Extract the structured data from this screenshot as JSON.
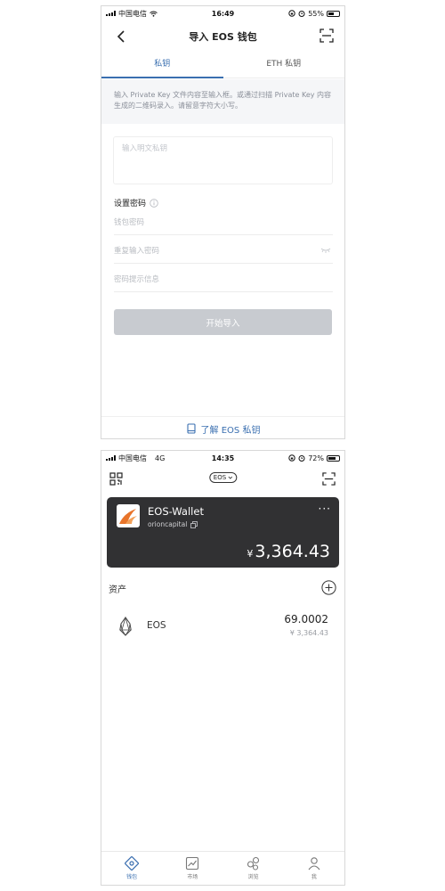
{
  "screen1": {
    "status": {
      "carrier": "中国电信",
      "time": "16:49",
      "battery": "55%",
      "battery_level": 0.55
    },
    "title": "导入 EOS 钱包",
    "tabs": [
      {
        "label": "私钥",
        "active": true
      },
      {
        "label": "ETH 私钥",
        "active": false
      }
    ],
    "hint": "输入 Private Key 文件内容至输入框。或通过扫描 Private Key 内容生成的二维码录入。请留意字符大小写。",
    "private_key_placeholder": "输入明文私钥",
    "password_section_title": "设置密码",
    "fields": [
      {
        "placeholder": "钱包密码"
      },
      {
        "placeholder": "重复输入密码"
      },
      {
        "placeholder": "密码提示信息"
      }
    ],
    "start_button": "开始导入",
    "learn_link": "了解 EOS 私钥"
  },
  "screen2": {
    "status": {
      "carrier": "中国电信",
      "network": "4G",
      "time": "14:35",
      "battery": "72%",
      "battery_level": 0.72
    },
    "chain_selector": "EOS",
    "wallet": {
      "name": "EOS-Wallet",
      "account": "orioncapital",
      "currency_symbol": "¥",
      "balance": "3,364.43"
    },
    "assets_title": "资产",
    "assets": [
      {
        "name": "EOS",
        "amount": "69.0002",
        "value": "¥ 3,364.43"
      }
    ],
    "bottom_nav": [
      {
        "label": "钱包",
        "icon": "wallet-icon",
        "active": true
      },
      {
        "label": "市场",
        "icon": "market-icon",
        "active": false
      },
      {
        "label": "浏览",
        "icon": "browse-icon",
        "active": false
      },
      {
        "label": "我",
        "icon": "profile-icon",
        "active": false
      }
    ],
    "colors": {
      "accent": "#3a6fb0",
      "card": "#313133",
      "logo_orange": "#e8742a"
    }
  }
}
